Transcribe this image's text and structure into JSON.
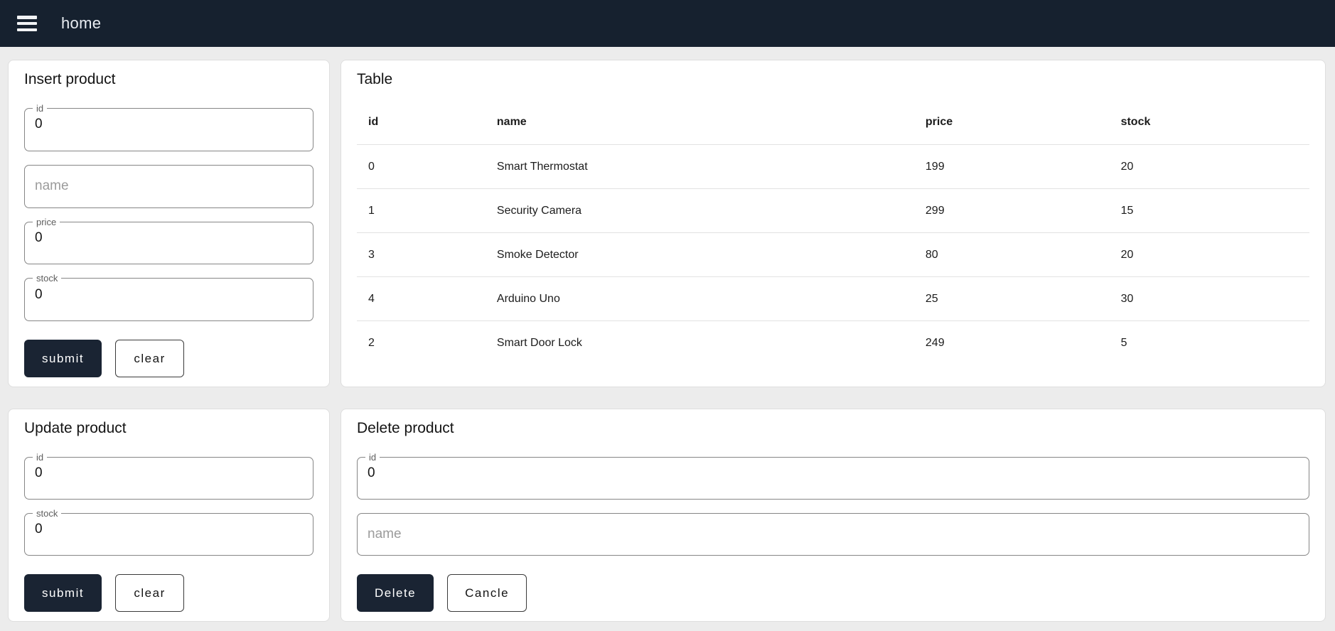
{
  "navbar": {
    "title": "home"
  },
  "insert_panel": {
    "title": "Insert product",
    "id_label": "id",
    "id_value": "0",
    "name_placeholder": "name",
    "price_label": "price",
    "price_value": "0",
    "stock_label": "stock",
    "stock_value": "0",
    "submit_label": "submit",
    "clear_label": "clear"
  },
  "table_panel": {
    "title": "Table",
    "columns": [
      "id",
      "name",
      "price",
      "stock"
    ],
    "rows": [
      [
        "0",
        "Smart Thermostat",
        "199",
        "20"
      ],
      [
        "1",
        "Security Camera",
        "299",
        "15"
      ],
      [
        "3",
        "Smoke Detector",
        "80",
        "20"
      ],
      [
        "4",
        "Arduino Uno",
        "25",
        "30"
      ],
      [
        "2",
        "Smart Door Lock",
        "249",
        "5"
      ]
    ]
  },
  "update_panel": {
    "title": "Update product",
    "id_label": "id",
    "id_value": "0",
    "stock_label": "stock",
    "stock_value": "0",
    "submit_label": "submit",
    "clear_label": "clear"
  },
  "delete_panel": {
    "title": "Delete product",
    "id_label": "id",
    "id_value": "0",
    "name_placeholder": "name",
    "delete_label": "Delete",
    "cancel_label": "Cancle"
  },
  "colors": {
    "navbar_bg": "#16212f",
    "button_dark_bg": "#1a2433",
    "page_bg": "#ececec",
    "card_bg": "#ffffff"
  }
}
